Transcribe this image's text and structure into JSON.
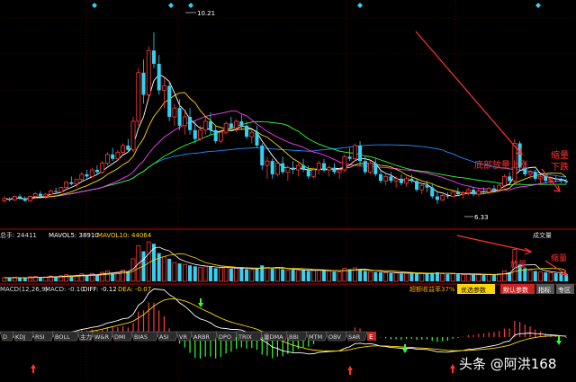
{
  "colors": {
    "up": "#ff3b3b",
    "down": "#34d2f0",
    "ma5": "#ffffff",
    "ma10": "#ffd700",
    "ma20": "#ff3cff",
    "ma30": "#33ff33",
    "ma60": "#1e90ff",
    "vol_ma5": "#ffffff",
    "vol_ma10": "#ffd700",
    "diff": "#ffffff",
    "dea": "#ffd700",
    "arrow": "#ff3333"
  },
  "price_panel": {
    "high_label": "10.21",
    "low_label": "6.33",
    "annotation_bottom_volume_up": "底部放量上涨",
    "annotation_shrink": "缩量",
    "annotation_fall": "下跌"
  },
  "volume_panel": {
    "header_left": "总手: 24411",
    "header_mavol5": "MAVOL5: 38910",
    "header_mavol10": "MAVOL10: 44064",
    "title_right": "成交量",
    "annotation_up": "放量",
    "annotation_shrink": "缩量",
    "btn_ratio": "超额收益率37%",
    "btn_optimize": "优选参数",
    "btn_default": "默认参数",
    "btn_indicator": "指标",
    "btn_expert": "专区"
  },
  "macd_panel": {
    "header_name": "MACD(12,26,9)",
    "header_macd": "MACD: -0.10",
    "header_diff": "DIFF: -0.12",
    "header_dea": "DEA: -0.07",
    "tabs": [
      "D",
      "KDJ",
      "RSI",
      "BOLL",
      "主力",
      "W&R",
      "DMI",
      "BIAS",
      "ASI",
      "VR",
      "ARBR",
      "DPO",
      "TRIX",
      "量DMA",
      "BBI",
      "MTM",
      "OBV",
      "SAR"
    ],
    "tab_end": "E"
  },
  "watermark": "头条 @阿洪168",
  "chart_data": {
    "type": "candlestick",
    "ylim": [
      5.9,
      10.7
    ],
    "n_bars": 110,
    "candles": [
      [
        6.4,
        6.5,
        6.35,
        6.45
      ],
      [
        6.45,
        6.48,
        6.38,
        6.42
      ],
      [
        6.42,
        6.52,
        6.4,
        6.5
      ],
      [
        6.5,
        6.55,
        6.42,
        6.46
      ],
      [
        6.46,
        6.5,
        6.38,
        6.4
      ],
      [
        6.4,
        6.52,
        6.38,
        6.5
      ],
      [
        6.5,
        6.6,
        6.45,
        6.56
      ],
      [
        6.56,
        6.62,
        6.48,
        6.5
      ],
      [
        6.5,
        6.58,
        6.45,
        6.55
      ],
      [
        6.55,
        6.65,
        6.5,
        6.62
      ],
      [
        6.62,
        6.7,
        6.55,
        6.6
      ],
      [
        6.6,
        6.72,
        6.58,
        6.7
      ],
      [
        6.7,
        6.85,
        6.65,
        6.82
      ],
      [
        6.82,
        6.95,
        6.75,
        6.78
      ],
      [
        6.78,
        6.9,
        6.7,
        6.88
      ],
      [
        6.88,
        7.05,
        6.85,
        7.0
      ],
      [
        7.0,
        7.1,
        6.9,
        6.95
      ],
      [
        6.95,
        7.15,
        6.92,
        7.1
      ],
      [
        7.1,
        7.2,
        7.0,
        7.05
      ],
      [
        7.05,
        7.3,
        7.0,
        7.25
      ],
      [
        7.25,
        7.5,
        7.2,
        7.45
      ],
      [
        7.45,
        7.6,
        7.3,
        7.35
      ],
      [
        7.35,
        7.55,
        7.3,
        7.5
      ],
      [
        7.5,
        7.7,
        7.45,
        7.65
      ],
      [
        7.65,
        7.8,
        7.5,
        7.55
      ],
      [
        7.55,
        8.3,
        7.5,
        8.2
      ],
      [
        8.2,
        9.4,
        8.1,
        9.3
      ],
      [
        9.3,
        9.6,
        8.6,
        8.8
      ],
      [
        8.8,
        9.9,
        8.7,
        9.8
      ],
      [
        9.8,
        10.21,
        9.4,
        9.5
      ],
      [
        9.5,
        9.7,
        8.8,
        8.9
      ],
      [
        8.9,
        9.2,
        8.5,
        9.0
      ],
      [
        9.0,
        9.1,
        8.2,
        8.3
      ],
      [
        8.3,
        8.6,
        8.1,
        8.5
      ],
      [
        8.5,
        8.7,
        8.0,
        8.1
      ],
      [
        8.1,
        8.4,
        7.9,
        8.3
      ],
      [
        8.3,
        8.5,
        7.9,
        8.0
      ],
      [
        8.0,
        8.2,
        7.7,
        7.8
      ],
      [
        7.8,
        8.1,
        7.75,
        8.0
      ],
      [
        8.0,
        8.3,
        7.9,
        8.2
      ],
      [
        8.2,
        8.4,
        7.9,
        8.0
      ],
      [
        8.0,
        8.1,
        7.7,
        7.75
      ],
      [
        7.75,
        8.0,
        7.7,
        7.95
      ],
      [
        7.95,
        8.2,
        7.9,
        8.15
      ],
      [
        8.15,
        8.3,
        8.0,
        8.05
      ],
      [
        8.05,
        8.25,
        7.95,
        8.2
      ],
      [
        8.2,
        8.35,
        8.0,
        8.1
      ],
      [
        8.1,
        8.2,
        7.8,
        7.85
      ],
      [
        7.85,
        8.0,
        7.7,
        7.95
      ],
      [
        7.95,
        8.1,
        7.6,
        7.65
      ],
      [
        7.65,
        7.7,
        7.1,
        7.2
      ],
      [
        7.2,
        7.4,
        6.9,
        7.3
      ],
      [
        7.3,
        7.35,
        6.9,
        7.0
      ],
      [
        7.0,
        7.3,
        6.95,
        7.25
      ],
      [
        7.25,
        7.4,
        7.0,
        7.05
      ],
      [
        7.05,
        7.2,
        6.85,
        7.15
      ],
      [
        7.15,
        7.3,
        7.0,
        7.1
      ],
      [
        7.1,
        7.25,
        6.95,
        7.2
      ],
      [
        7.2,
        7.35,
        7.05,
        7.1
      ],
      [
        7.1,
        7.2,
        6.9,
        6.95
      ],
      [
        6.95,
        7.15,
        6.9,
        7.1
      ],
      [
        7.1,
        7.3,
        7.0,
        7.25
      ],
      [
        7.25,
        7.35,
        7.05,
        7.1
      ],
      [
        7.1,
        7.2,
        6.95,
        7.15
      ],
      [
        7.15,
        7.25,
        7.0,
        7.05
      ],
      [
        7.05,
        7.15,
        6.9,
        7.1
      ],
      [
        7.1,
        7.45,
        7.05,
        7.4
      ],
      [
        7.4,
        7.6,
        7.3,
        7.35
      ],
      [
        7.35,
        7.7,
        7.3,
        7.65
      ],
      [
        7.65,
        7.75,
        7.2,
        7.3
      ],
      [
        7.3,
        7.4,
        7.0,
        7.05
      ],
      [
        7.05,
        7.3,
        7.0,
        7.25
      ],
      [
        7.25,
        7.35,
        6.95,
        7.0
      ],
      [
        7.0,
        7.1,
        6.8,
        6.85
      ],
      [
        6.85,
        7.0,
        6.75,
        6.95
      ],
      [
        6.95,
        7.05,
        6.8,
        6.85
      ],
      [
        6.85,
        6.95,
        6.7,
        6.9
      ],
      [
        6.9,
        7.0,
        6.75,
        6.8
      ],
      [
        6.8,
        6.95,
        6.72,
        6.9
      ],
      [
        6.9,
        7.0,
        6.8,
        6.85
      ],
      [
        6.85,
        6.9,
        6.6,
        6.65
      ],
      [
        6.65,
        6.8,
        6.55,
        6.75
      ],
      [
        6.75,
        6.85,
        6.6,
        6.7
      ],
      [
        6.7,
        6.8,
        6.45,
        6.5
      ],
      [
        6.5,
        6.6,
        6.33,
        6.42
      ],
      [
        6.42,
        6.55,
        6.4,
        6.52
      ],
      [
        6.52,
        6.6,
        6.45,
        6.5
      ],
      [
        6.5,
        6.65,
        6.48,
        6.6
      ],
      [
        6.6,
        6.7,
        6.5,
        6.55
      ],
      [
        6.55,
        6.62,
        6.45,
        6.58
      ],
      [
        6.58,
        6.7,
        6.52,
        6.65
      ],
      [
        6.65,
        6.72,
        6.5,
        6.55
      ],
      [
        6.55,
        6.68,
        6.5,
        6.62
      ],
      [
        6.62,
        6.7,
        6.55,
        6.6
      ],
      [
        6.6,
        6.72,
        6.55,
        6.68
      ],
      [
        6.68,
        6.75,
        6.6,
        6.65
      ],
      [
        6.65,
        6.8,
        6.6,
        6.75
      ],
      [
        6.75,
        7.0,
        6.7,
        6.95
      ],
      [
        6.95,
        7.05,
        6.8,
        6.85
      ],
      [
        6.85,
        7.8,
        6.8,
        7.7
      ],
      [
        7.7,
        7.75,
        7.1,
        7.15
      ],
      [
        7.15,
        7.3,
        6.95,
        7.0
      ],
      [
        7.0,
        7.1,
        6.9,
        7.05
      ],
      [
        7.05,
        7.1,
        6.85,
        6.9
      ],
      [
        6.9,
        7.0,
        6.8,
        6.95
      ],
      [
        6.95,
        7.0,
        6.8,
        6.85
      ],
      [
        6.85,
        6.95,
        6.78,
        6.9
      ],
      [
        6.9,
        6.95,
        6.82,
        6.88
      ],
      [
        6.88,
        6.92,
        6.8,
        6.85
      ],
      [
        6.85,
        6.9,
        6.78,
        6.82
      ]
    ],
    "volume": [
      20,
      18,
      22,
      19,
      17,
      24,
      26,
      21,
      23,
      28,
      25,
      30,
      35,
      27,
      32,
      40,
      30,
      42,
      35,
      48,
      55,
      45,
      50,
      60,
      52,
      120,
      190,
      160,
      210,
      200,
      150,
      130,
      120,
      100,
      95,
      90,
      85,
      80,
      75,
      80,
      78,
      70,
      72,
      75,
      68,
      70,
      72,
      65,
      62,
      70,
      85,
      75,
      68,
      72,
      65,
      60,
      62,
      58,
      60,
      55,
      58,
      62,
      58,
      55,
      52,
      50,
      70,
      65,
      72,
      60,
      55,
      52,
      50,
      48,
      46,
      44,
      45,
      42,
      44,
      42,
      40,
      42,
      40,
      45,
      48,
      40,
      38,
      40,
      38,
      36,
      38,
      35,
      36,
      34,
      36,
      38,
      40,
      55,
      48,
      170,
      90,
      70,
      60,
      55,
      50,
      48,
      45,
      44,
      42,
      40
    ],
    "volume_max": 220,
    "macd_range": [
      -0.55,
      0.55
    ]
  }
}
